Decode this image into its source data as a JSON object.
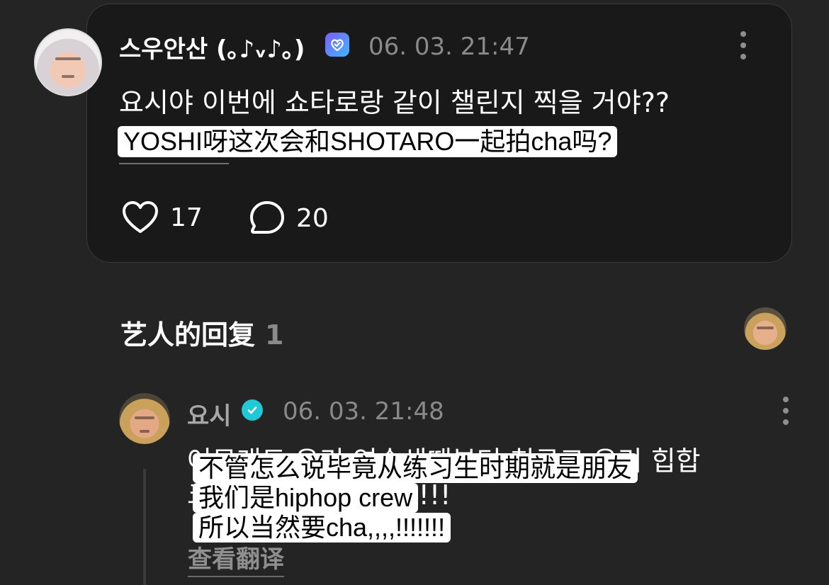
{
  "post": {
    "author": "스우안산 (｡♪ᵥ♪｡)",
    "timestamp": "06. 03. 21:47",
    "text": "요시야 이번에 쇼타로랑 같이 챌린지 찍을 거야??",
    "translation": "YOSHI呀这次会和SHOTARO一起拍cha吗?",
    "likes": "17",
    "comments": "20"
  },
  "artist_replies": {
    "title": "艺人的回复",
    "count": "1"
  },
  "reply": {
    "author": "요시",
    "timestamp": "06. 03. 21:48",
    "text_lines": [
      "어무래도 우리 연습생때부터 친구고 우리 힙합",
      "크루                   하는데,,,,!!!!!!!!!",
      ""
    ],
    "translation_lines": [
      "不管怎么说毕竟从练习生时期就是朋友",
      "我们是hiphop crew",
      "所以当然要cha,,,,!!!!!!!"
    ],
    "view_translation_label": "查看翻译"
  },
  "icons": {
    "verified_fan": "verified-badge-icon",
    "verified_artist": "verified-check-icon",
    "like": "heart-icon",
    "comment": "comment-bubble-icon",
    "more": "more-vertical-icon"
  },
  "colors": {
    "background": "#242424",
    "card": "#191919",
    "artist_badge": "#21c9d6",
    "fan_badge_start": "#7b5cff",
    "fan_badge_end": "#3fb8ff"
  }
}
